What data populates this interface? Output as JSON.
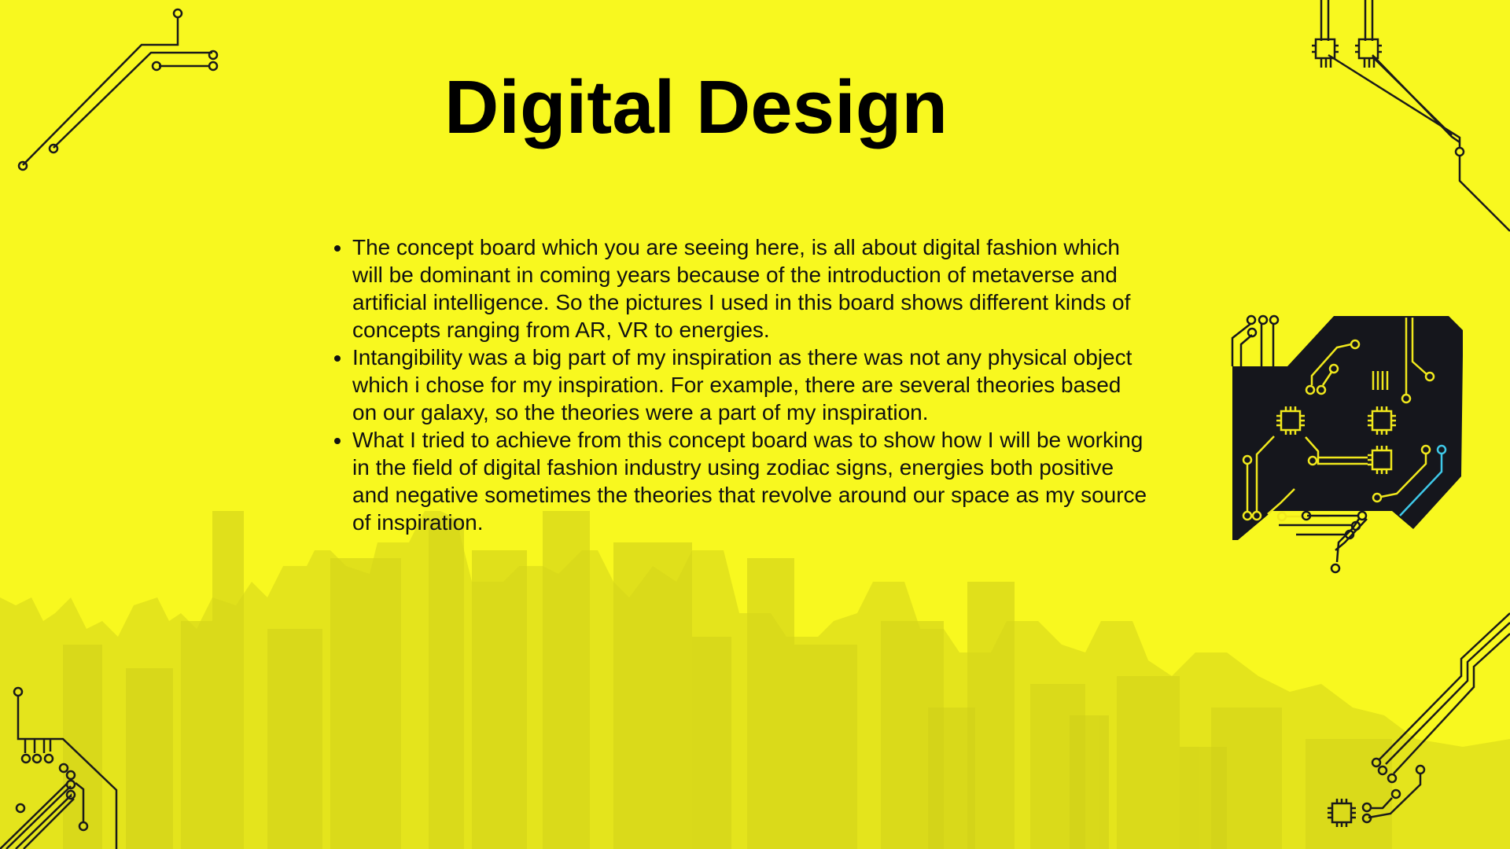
{
  "slide": {
    "title": "Digital Design",
    "bullets": [
      "The concept board which you are seeing here, is all about digital fashion which will be dominant in coming years because of the introduction of metaverse and artificial intelligence. So the pictures I used in this board shows different kinds of concepts ranging from AR, VR to energies.",
      "Intangibility was a big part of my inspiration as there was not any physical object which i chose for my inspiration. For example, there are several theories based on our galaxy, so the theories were a part of my inspiration.",
      "What I tried to achieve from this concept board was to show how I will be working in the field of digital fashion industry using zodiac signs, energies both positive and negative sometimes the theories that revolve around our space as my source of inspiration."
    ]
  },
  "icons": {
    "corner_circuits": "circuit-line-icon",
    "chip": "microchip-icon",
    "circuit_board": "circuit-board-icon"
  },
  "colors": {
    "background": "#f8f81f",
    "skyline": "#d9d91a",
    "circuit_line": "#1a1a1a",
    "board_fill": "#15161c",
    "board_trace": "#f0e81c",
    "board_accent": "#3ec8e8"
  }
}
